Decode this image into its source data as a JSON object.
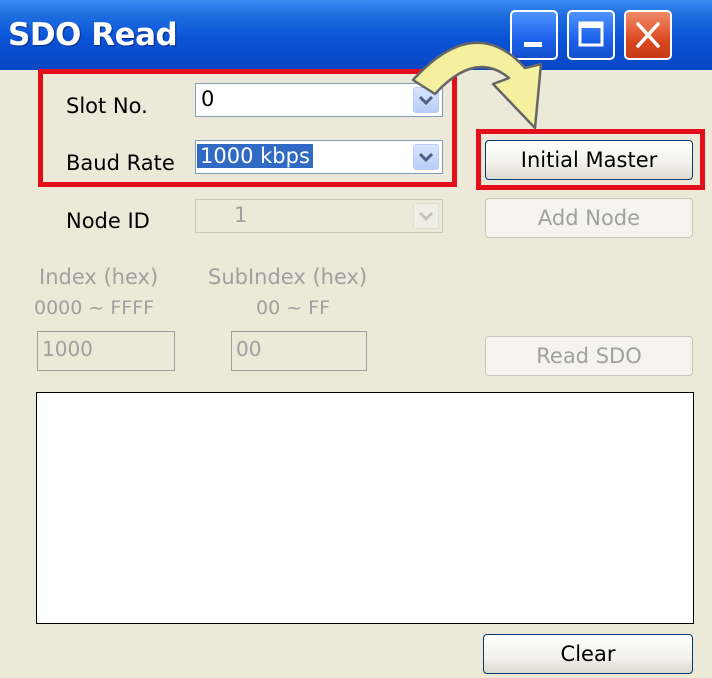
{
  "window": {
    "title": "SDO Read",
    "controls": [
      "minimize-icon",
      "maximize-icon",
      "close-icon"
    ]
  },
  "slot": {
    "label": "Slot No.",
    "value": "0"
  },
  "baud": {
    "label": "Baud Rate",
    "value": "1000 kbps"
  },
  "node": {
    "label": "Node ID",
    "value": "1"
  },
  "buttons": {
    "initial_master": "Initial Master",
    "add_node": "Add Node",
    "read_sdo": "Read SDO",
    "clear": "Clear"
  },
  "index": {
    "label": "Index (hex)",
    "range": "0000 ~ FFFF",
    "value": "1000"
  },
  "subindex": {
    "label": "SubIndex (hex)",
    "range": "00 ~ FF",
    "value": "00"
  },
  "output": {
    "text": ""
  },
  "colors": {
    "highlight": "#e30f1a",
    "arrow_fill": "#f4f0a0",
    "selection": "#316ac5",
    "titlebar": "#0a53d6"
  }
}
